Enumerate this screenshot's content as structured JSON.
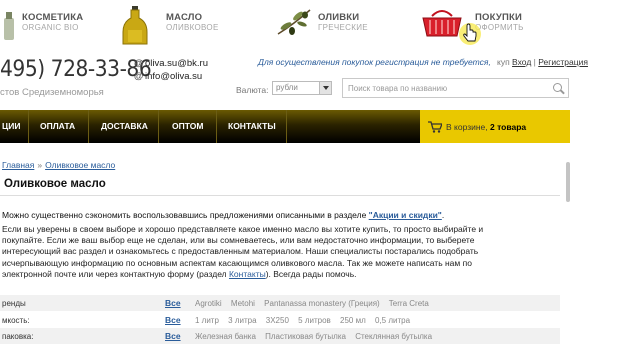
{
  "categories": [
    {
      "title": "КОСМЕТИКА",
      "subtitle": "ORGANIC BIO",
      "icon": "cosmetics-bottle-icon"
    },
    {
      "title": "МАСЛО",
      "subtitle": "ОЛИВКОВОЕ",
      "icon": "oil-bottle-icon"
    },
    {
      "title": "ОЛИВКИ",
      "subtitle": "ГРЕЧЕСКИЕ",
      "icon": "olive-branch-icon"
    },
    {
      "title": "ПОКУПКИ",
      "subtitle": "ОФОРМИТЬ",
      "icon": "shopping-basket-icon"
    }
  ],
  "header": {
    "phone": "495) 728-33-86",
    "phone_sub": "стов Средиземноморья",
    "emails": [
      "oliva.su@bk.ru",
      "info@oliva.su"
    ],
    "reg_note": "Для осуществления покупок регистрация не требуется,",
    "login": "Вход",
    "login_sep": "|",
    "register": "Регистрация",
    "login_prefix": "куп"
  },
  "toolbar": {
    "currency_label": "Валюта:",
    "currency_value": "рубли",
    "search_placeholder": "Поиск товара по названию"
  },
  "nav": {
    "items": [
      "ЦИИ",
      "ОПЛАТА",
      "ДОСТАВКА",
      "ОПТОМ",
      "КОНТАКТЫ"
    ],
    "cart_prefix": "В корзине,",
    "cart_count": "2 товара"
  },
  "breadcrumb": {
    "home": "Главная",
    "sep": "»",
    "current": "Оливковое масло"
  },
  "page": {
    "title": "Оливковое масло",
    "intro_text": "Можно существенно сэкономить воспользовавшись предложениями описанными в разделе",
    "intro_link": "\"Акции и скидки\"",
    "intro_end": ".",
    "lines": [
      "Если вы уверены в своем выборе и хорошо представляете какое именно масло вы хотите купить, то просто выбирайте и",
      "покупайте. Если же ваш выбор еще не сделан, или вы сомневаетесь, или вам недостаточно информации, то выберете",
      "интересующий вас раздел и ознакомьтесь с предоставленным материалом. Наши специалисты постарались подобрать",
      "исчерпывающую информацию по основным аспектам касающимся оливкового масла. Так же можете написать нам по"
    ],
    "last_line_pre": "электронной почте или через контактную форму (раздел",
    "last_line_link": "Контакты",
    "last_line_post": "). Всегда рады помочь."
  },
  "filters": [
    {
      "label": "ренды",
      "all": "Все",
      "options": [
        "Agrotiki",
        "Metohi",
        "Pantanassa monastery (Греция)",
        "Terra Creta"
      ]
    },
    {
      "label": "мкость:",
      "all": "Все",
      "options": [
        "1 литр",
        "3 литра",
        "3X250",
        "5 литров",
        "250 мл",
        "0,5 литра"
      ]
    },
    {
      "label": "паковка:",
      "all": "Все",
      "options": [
        "Железная банка",
        "Пластиковая бутылка",
        "Стеклянная бутылка"
      ]
    }
  ]
}
